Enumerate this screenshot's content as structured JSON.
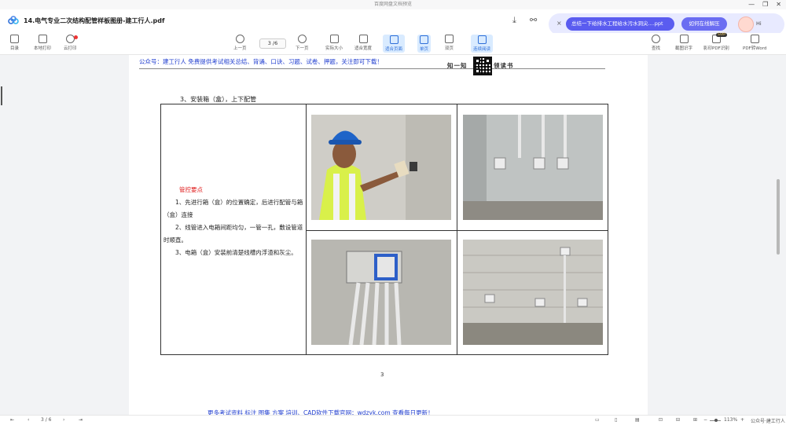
{
  "window": {
    "title": "百度网盘文档预览",
    "controls": [
      "—",
      "❐",
      "✕"
    ]
  },
  "header": {
    "doc_title": "14.电气专业二次结构配管样板图册-建工行人.pdf",
    "ad": {
      "close": "×",
      "chip": "总结一下给排水工程给水污水洞尖....ppt",
      "button": "如何在线解压",
      "greeting": "Hi"
    }
  },
  "toolbar": {
    "left": [
      "目录",
      "本地打印",
      "云打印"
    ],
    "center": [
      "上一页",
      "下一页",
      "实际大小",
      "适合宽度",
      "适合页面",
      "单页",
      "双页",
      "连续阅读"
    ],
    "page_indicator": "3 /6",
    "right": [
      "查找",
      "截图识字",
      "影印PDF识别",
      "PDF转Word"
    ],
    "svip": "SVIP"
  },
  "document": {
    "promo_top": "公众号：建工行人 免费提供考试相关总结、背诵、口诀、习题、试卷、押题，关注即可下载！",
    "brand": [
      "知一知",
      "领读书"
    ],
    "section_heading": "3、安装箱（盒），上下配管",
    "notes": {
      "title": "管控要点",
      "items": [
        "1、先进行箱（盒）的位置确定，后进行配管与箱（盒）连接",
        "2、线管进入电箱间距均匀，一管一孔，敷设管道时顺直。",
        "3、电箱（盒）安装前清楚线槽内浮渣和灰尘。"
      ]
    },
    "page_number": "3",
    "promo_bottom": "更多考试资料 标注 图集 方案 培训、CAD软件下载官网：wdzyk.com 查看每日更新！"
  },
  "statusbar": {
    "page": "3 / 6",
    "zoom": "113%",
    "watermark": "公众号·建工行人"
  }
}
